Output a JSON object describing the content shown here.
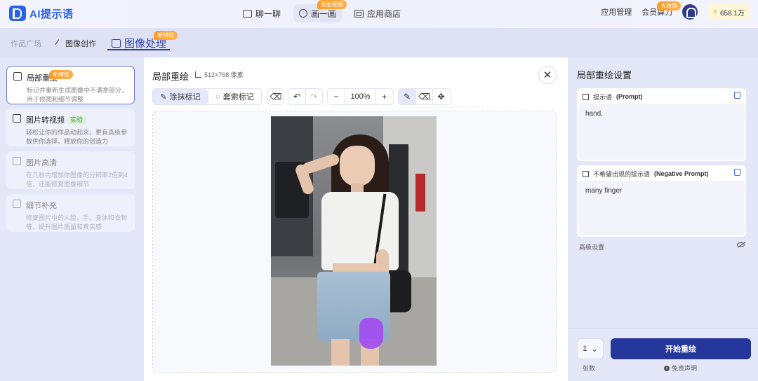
{
  "header": {
    "logo_text": "AI提示语",
    "nav": [
      {
        "label": "聊一聊"
      },
      {
        "label": "画一画",
        "badge": "图生视频"
      },
      {
        "label": "应用商店"
      }
    ],
    "app_manage": "应用管理",
    "member": "会员算力",
    "member_badge": "大改版",
    "balance": "658.1万"
  },
  "subtabs": {
    "gallery": "作品广场",
    "create": "图像创作",
    "process": "图像处理",
    "process_badge": "新特性"
  },
  "sidebar": {
    "items": [
      {
        "title": "局部重绘",
        "badge": "新特性",
        "desc": "标记并重新生成图像中不满意部分，用于修图和细节调整"
      },
      {
        "title": "图片转视频",
        "tag": "实验",
        "desc": "轻松让你的作品动起来，更有高级参数供你选择，释放你的创造力"
      },
      {
        "title": "图片高清",
        "desc": "在几秒内增加你图像的分辨率2倍到4倍，还能修复图像细节"
      },
      {
        "title": "细节补充",
        "desc": "修复图片中的人脸、手、身体和衣物等，提升图片质量和真实感"
      }
    ]
  },
  "main": {
    "title": "局部重绘",
    "size": "512×768 像素",
    "close": "✕",
    "tools": {
      "smear": "涂抹标记",
      "lasso": "套索标记",
      "zoom": "100%"
    },
    "brush_size": 0.3
  },
  "right": {
    "title": "局部重绘设置",
    "prompt_label": "提示语",
    "prompt_label_en": "(Prompt)",
    "prompt_value": "hand,",
    "neg_label": "不希望出现的提示语",
    "neg_label_en": "(Negative Prompt)",
    "neg_value": "many finger",
    "advanced": "高级设置",
    "count": "1",
    "start": "开始重绘",
    "count_label": "张数",
    "disclaimer": "免责声明"
  }
}
